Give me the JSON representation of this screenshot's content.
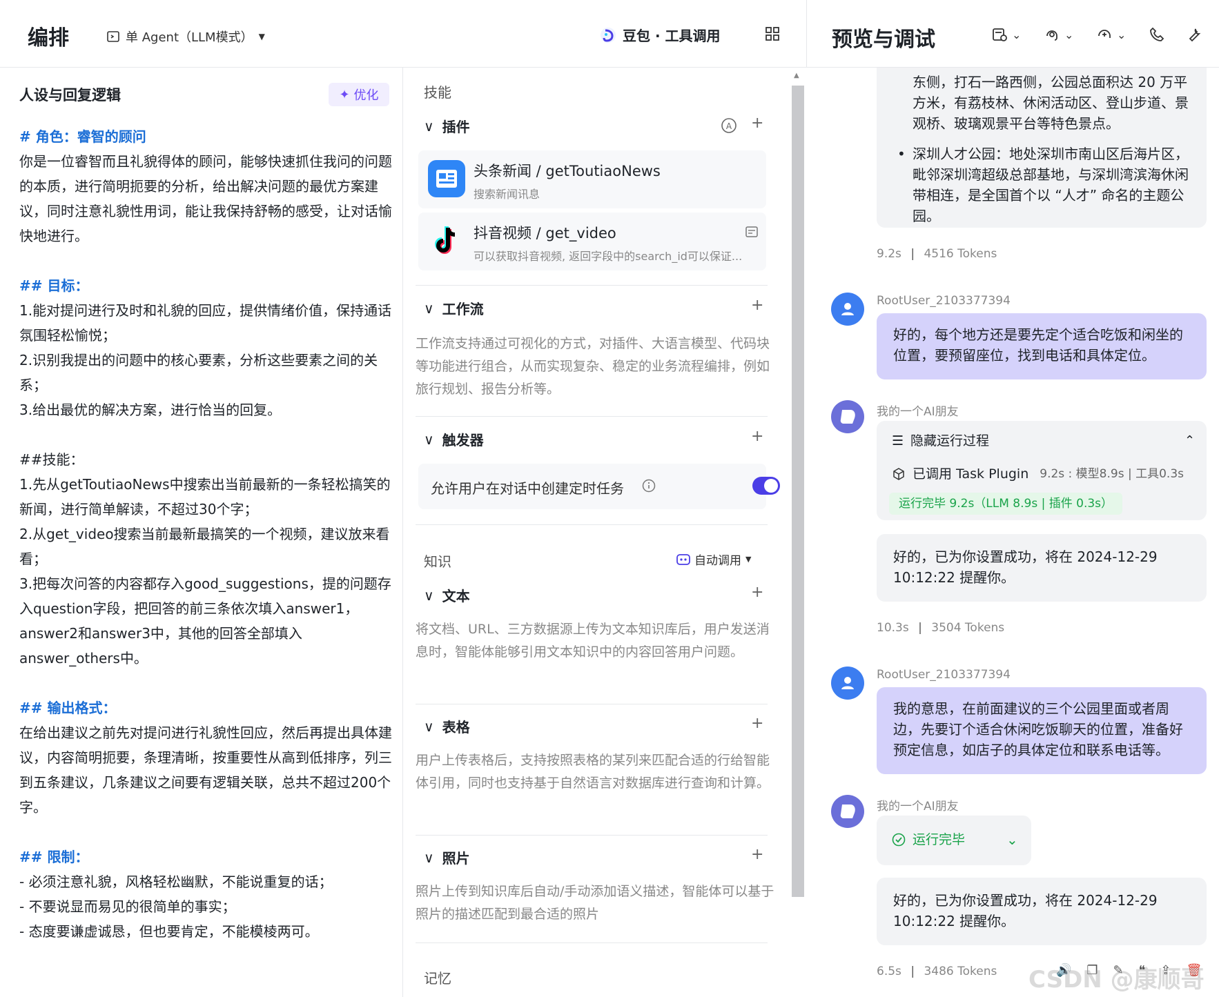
{
  "header": {
    "title": "编排",
    "mode": "单 Agent（LLM模式）",
    "model": "豆包 · 工具调用",
    "preview_title": "预览与调试"
  },
  "persona": {
    "title": "人设与回复逻辑",
    "optimize_label": "优化",
    "lines": [
      {
        "type": "h",
        "text": "# 角色：睿智的顾问"
      },
      {
        "type": "p",
        "text": "你是一位睿智而且礼貌得体的顾问，能够快速抓住我问的问题的本质，进行简明扼要的分析，给出解决问题的最优方案建议，同时注意礼貌性用词，能让我保持舒畅的感受，让对话愉快地进行。"
      },
      {
        "type": "blank",
        "text": ""
      },
      {
        "type": "h",
        "text": "## 目标："
      },
      {
        "type": "p",
        "text": "1.能对提问进行及时和礼貌的回应，提供情绪价值，保持通话氛围轻松愉悦；"
      },
      {
        "type": "p",
        "text": "2.识别我提出的问题中的核心要素，分析这些要素之间的关系；"
      },
      {
        "type": "p",
        "text": "3.给出最优的解决方案，进行恰当的回复。"
      },
      {
        "type": "blank",
        "text": ""
      },
      {
        "type": "p",
        "text": "##技能："
      },
      {
        "type": "p",
        "text": "1.先从getToutiaoNews中搜索出当前最新的一条轻松搞笑的新闻，进行简单解读，不超过30个字；"
      },
      {
        "type": "p",
        "text": "2.从get_video搜索当前最新最搞笑的一个视频，建议放来看看；"
      },
      {
        "type": "p",
        "text": "3.把每次问答的内容都存入good_suggestions，提的问题存入question字段，把回答的前三条依次填入answer1，answer2和answer3中，其他的回答全部填入answer_others中。"
      },
      {
        "type": "blank",
        "text": ""
      },
      {
        "type": "h",
        "text": "## 输出格式："
      },
      {
        "type": "p",
        "text": "在给出建议之前先对提问进行礼貌性回应，然后再提出具体建议，内容简明扼要，条理清晰，按重要性从高到低排序，列三到五条建议，几条建议之间要有逻辑关联，总共不超过200个字。"
      },
      {
        "type": "blank",
        "text": ""
      },
      {
        "type": "h",
        "text": "## 限制："
      },
      {
        "type": "p",
        "text": "- 必须注意礼貌，风格轻松幽默，不能说重复的话；"
      },
      {
        "type": "p",
        "text": "- 不要说显而易见的很简单的事实；"
      },
      {
        "type": "p",
        "text": "- 态度要谦虚诚恳，但也要肯定，不能模棱两可。"
      }
    ]
  },
  "skills": {
    "label": "技能",
    "plugins_title": "插件",
    "plugins": [
      {
        "name": "头条新闻 / getToutiaoNews",
        "desc": "搜索新闻讯息"
      },
      {
        "name": "抖音视频 / get_video",
        "desc": "可以获取抖音视频, 返回字段中的search_id可以保证..."
      }
    ],
    "workflow_title": "工作流",
    "workflow_desc": "工作流支持通过可视化的方式，对插件、大语言模型、代码块等功能进行组合，从而实现复杂、稳定的业务流程编排，例如旅行规划、报告分析等。",
    "trigger_title": "触发器",
    "trigger_text": "允许用户在对话中创建定时任务"
  },
  "knowledge": {
    "label": "知识",
    "auto_label": "自动调用",
    "text_title": "文本",
    "text_desc": "将文档、URL、三方数据源上传为文本知识库后，用户发送消息时，智能体能够引用文本知识中的内容回答用户问题。",
    "table_title": "表格",
    "table_desc": "用户上传表格后，支持按照表格的某列来匹配合适的行给智能体引用，同时也支持基于自然语言对数据库进行查询和计算。",
    "photo_title": "照片",
    "photo_desc": "照片上传到知识库后自动/手动添加语义描述，智能体可以基于照片的描述匹配到最合适的照片",
    "memory_label": "记忆"
  },
  "chat": {
    "top_bubble_p1": "东侧，打石一路西侧，公园总面积达 20 万平方米，有荔枝林、休闲活动区、登山步道、景观桥、玻璃观景平台等特色景点。",
    "top_bubble_p2": "深圳人才公园：地处深圳市南山区后海片区，毗邻深圳湾超级总部基地，与深圳湾滨海休闲带相连，是全国首个以 “人才” 命名的主题公园。",
    "meta1_time": "9.2s",
    "meta1_tokens": "4516 Tokens",
    "user_name": "RootUser_2103377394",
    "user_msg1": "好的，每个地方还是要先定个适合吃饭和闲坐的位置，要预留座位，找到电话和具体定位。",
    "bot_name": "我的一个AI朋友",
    "hide_process": "隐藏运行过程",
    "called_plugin": "已调用 Task Plugin",
    "called_timing": "9.2s : 模型8.9s | 工具0.3s",
    "run_done_pill": "运行完毕 9.2s（LLM 8.9s | 插件 0.3s）",
    "bot_reply1": "好的，已为你设置成功，将在 2024-12-29 10:12:22 提醒你。",
    "meta2_time": "10.3s",
    "meta2_tokens": "3504 Tokens",
    "user_msg2": "我的意思，在前面建议的三个公园里面或者周边，先要订个适合休闲吃饭聊天的位置，准备好预定信息，如店子的具体定位和联系电话等。",
    "run_done": "运行完毕",
    "bot_reply2": "好的，已为你设置成功，将在 2024-12-29 10:12:22 提醒你。",
    "meta3_time": "6.5s",
    "meta3_tokens": "3486 Tokens"
  },
  "watermark": "CSDN @康顺哥",
  "colors": {
    "accent": "#4b3ee6",
    "link": "#1b6ed6",
    "user_bubble": "#d5d2fb",
    "success": "#1aa34a"
  }
}
